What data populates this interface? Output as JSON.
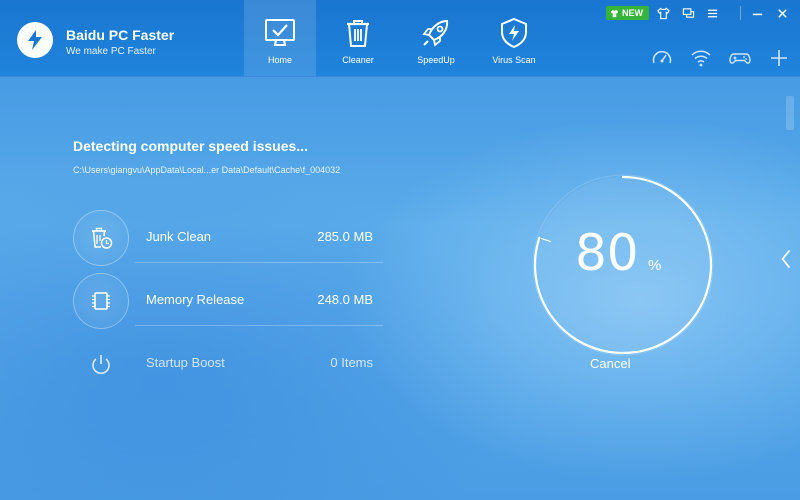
{
  "app": {
    "title": "Baidu PC Faster",
    "subtitle": "We make PC Faster"
  },
  "tabs": [
    {
      "label": "Home",
      "icon": "monitor-check-icon",
      "active": true
    },
    {
      "label": "Cleaner",
      "icon": "trash-icon",
      "active": false
    },
    {
      "label": "SpeedUp",
      "icon": "rocket-icon",
      "active": false
    },
    {
      "label": "Virus Scan",
      "icon": "shield-bolt-icon",
      "active": false
    }
  ],
  "window_controls": {
    "new_badge": "NEW"
  },
  "scan": {
    "title": "Detecting computer speed issues...",
    "path": "C:\\Users\\giangvu\\AppData\\Local...er Data\\Default\\Cache\\f_004032"
  },
  "items": [
    {
      "label": "Junk Clean",
      "value": "285.0 MB",
      "icon": "junk-clean-icon"
    },
    {
      "label": "Memory Release",
      "value": "248.0 MB",
      "icon": "memory-chip-icon"
    },
    {
      "label": "Startup Boost",
      "value": "0 Items",
      "icon": "power-icon"
    }
  ],
  "progress": {
    "value": "80",
    "unit": "%",
    "fraction": 0.8,
    "cancel_label": "Cancel"
  },
  "colors": {
    "header": "#1a76d0",
    "new_badge": "#36b43a",
    "background": "#4a9de4"
  }
}
